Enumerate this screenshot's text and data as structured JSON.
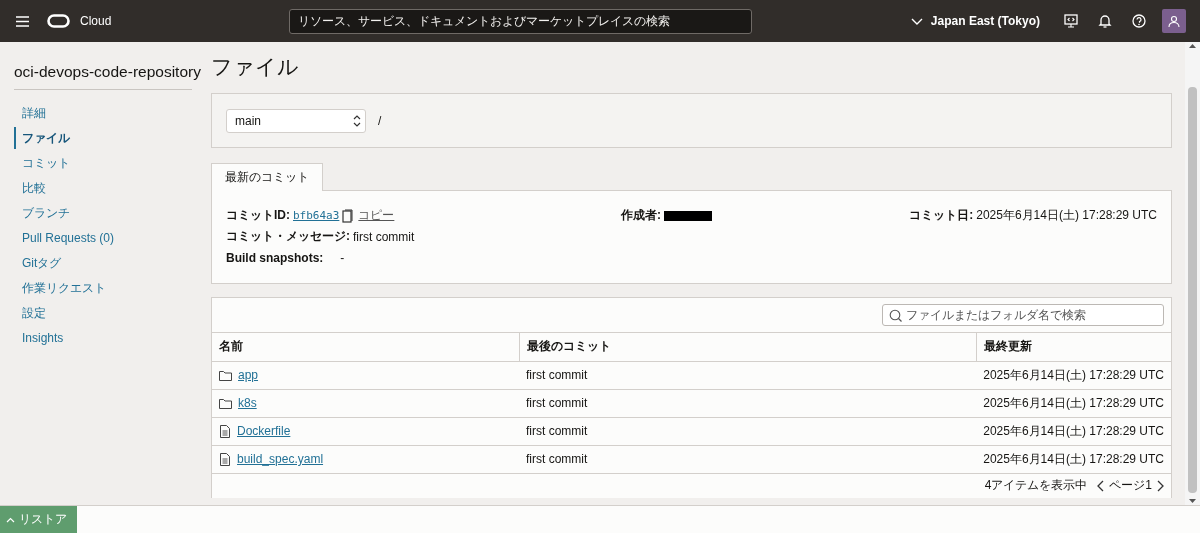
{
  "header": {
    "brand": "Cloud",
    "search": {
      "placeholder": "リソース、サービス、ドキュメントおよびマーケットプレイスの検索"
    },
    "region": "Japan East (Tokyo)"
  },
  "sidebar": {
    "title": "oci-devops-code-repository",
    "items": [
      {
        "label": "詳細",
        "selected": false
      },
      {
        "label": "ファイル",
        "selected": true
      },
      {
        "label": "コミット",
        "selected": false
      },
      {
        "label": "比較",
        "selected": false
      },
      {
        "label": "ブランチ",
        "selected": false
      },
      {
        "label": "Pull Requests (0)",
        "selected": false
      },
      {
        "label": "Gitタグ",
        "selected": false
      },
      {
        "label": "作業リクエスト",
        "selected": false
      },
      {
        "label": "設定",
        "selected": false
      },
      {
        "label": "Insights",
        "selected": false
      }
    ]
  },
  "page_title": "ファイル",
  "branch_select": {
    "value": "main"
  },
  "path": "/",
  "commit_tabs": [
    {
      "label": "最新のコミット",
      "selected": true
    }
  ],
  "commit": {
    "id_label": "コミットID:",
    "id": "bfb64a3",
    "copy": "コピー",
    "author_label": "作成者:",
    "date_label": "コミット日:",
    "date": "2025年6月14日(土) 17:28:29 UTC",
    "message_label": "コミット・メッセージ:",
    "message": "first commit",
    "snapshots_label": "Build snapshots:",
    "snapshots": "-"
  },
  "files": {
    "search": {
      "placeholder": "ファイルまたはフォルダ名で検索"
    },
    "columns": [
      "名前",
      "最後のコミット",
      "最終更新"
    ],
    "rows": [
      {
        "kind": "folder",
        "name": "app",
        "commit": "first commit",
        "updated": "2025年6月14日(土) 17:28:29 UTC"
      },
      {
        "kind": "folder",
        "name": "k8s",
        "commit": "first commit",
        "updated": "2025年6月14日(土) 17:28:29 UTC"
      },
      {
        "kind": "file",
        "name": "Dockerfile",
        "commit": "first commit",
        "updated": "2025年6月14日(土) 17:28:29 UTC"
      },
      {
        "kind": "file",
        "name": "build_spec.yaml",
        "commit": "first commit",
        "updated": "2025年6月14日(土) 17:28:29 UTC"
      }
    ],
    "footer": "4アイテムを表示中",
    "page": "ページ1"
  },
  "bottom_bar": {
    "restore": "リストア"
  }
}
